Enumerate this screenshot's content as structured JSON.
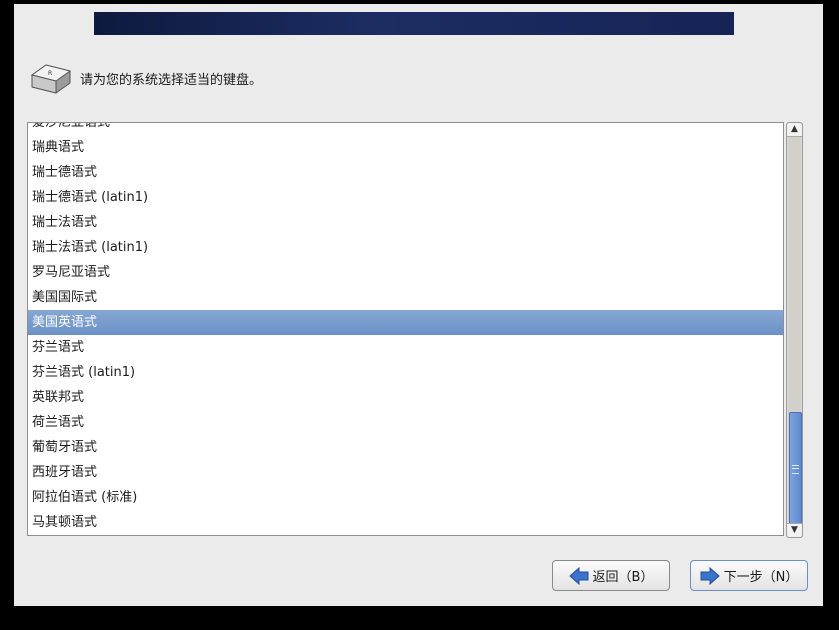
{
  "prompt": {
    "text": "请为您的系统选择适当的键盘。"
  },
  "keyboard_list": {
    "items": [
      "爱沙尼亚语式",
      "瑞典语式",
      "瑞士德语式",
      "瑞士德语式 (latin1)",
      "瑞士法语式",
      "瑞士法语式 (latin1)",
      "罗马尼亚语式",
      "美国国际式",
      "美国英语式",
      "芬兰语式",
      "芬兰语式 (latin1)",
      "英联邦式",
      "荷兰语式",
      "葡萄牙语式",
      "西班牙语式",
      "阿拉伯语式 (标准)",
      "马其顿语式"
    ],
    "selected": "美国英语式"
  },
  "scrollbar": {
    "position": 0.72
  },
  "buttons": {
    "back_label": "返回（B）",
    "next_label": "下一步（N）"
  },
  "colors": {
    "banner": "#1c2d62",
    "selection": "#7a9ccd",
    "background": "#ebebeb"
  },
  "icons": {
    "keyboard": "keyboard-key-icon",
    "back": "arrow-left-icon",
    "next": "arrow-right-icon"
  }
}
